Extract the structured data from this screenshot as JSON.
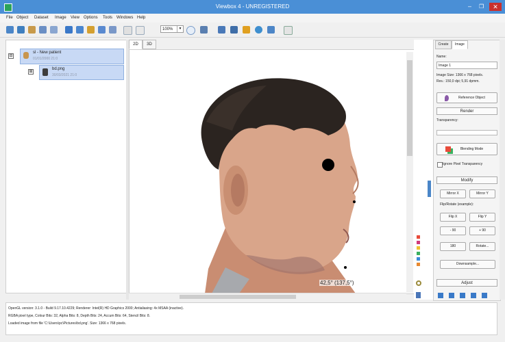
{
  "window": {
    "title": "Viewbox 4 - UNREGISTERED",
    "minimize": "–",
    "maximize": "❐",
    "close": "✕"
  },
  "menu": [
    "File",
    "Object",
    "Dataset",
    "Image",
    "View",
    "Options",
    "Tools",
    "Windows",
    "Help"
  ],
  "toolbar": {
    "zoom_value": "100%",
    "zoom_arrow": "▼"
  },
  "tree": {
    "patient": {
      "expander": "⊟",
      "label": "sl - New patient",
      "date": "01/01/2000 21:0"
    },
    "image": {
      "expander": "⊞",
      "label": "bd.png",
      "date": "30/03/2021 21:0"
    }
  },
  "view_tabs": [
    "2D",
    "3D"
  ],
  "viewport": {
    "angle_label": "42,5° (137,5°)"
  },
  "panel": {
    "tabs": [
      "Create",
      "Image"
    ],
    "name_label": "Name:",
    "name_value": "Image 1",
    "image_size": "Image Size: 1366 x 768 pixels.",
    "resolution": "Res.: 150,0 dpi; 5,91 dpmm.",
    "reference_button": "Reference Object",
    "render_header": "Render",
    "transparency_label": "Transparency:",
    "blending_button": "Blending Mode",
    "ignore_pixel_label": "Ignore Pixel Transparency",
    "modify_header": "Modify",
    "mirror_x": "Mirror X",
    "mirror_y": "Mirror Y",
    "flip_rotate_label": "Flip/Rotate (example):",
    "flip_x": "Flip X",
    "flip_y": "Flip Y",
    "rot_minus90": "- 90",
    "rot_plus90": "+ 90",
    "rot_180": "180",
    "rotate": "Rotate...",
    "downsample": "Downsample...",
    "adjust_header": "Adjust"
  },
  "console": {
    "line1": "OpenGL version: 3.1.0 - Build 9.17.10.4229; Renderer: Intel(R) HD Graphics 2000; Antialiasing: 4x MSAA (inactive).",
    "line2": "RGBA pixel type, Colour Bits: 32, Alpha Bits: 8, Depth Bits: 24, Accum Bits: 64, Stencil Bits: 8.",
    "line3": "Loaded image from file 'C:\\Users\\pc\\Pictures\\bd.png'. Size: 1366 x 768 pixels."
  },
  "colors": {
    "titlebar": "#4a8fd6",
    "selection": "#c8d9f5",
    "close": "#c9302c"
  },
  "icons": [
    "app-icon",
    "patient-icon",
    "image-icon",
    "pin-icon",
    "blend-icon",
    "gear-icon",
    "adjust-icon"
  ]
}
